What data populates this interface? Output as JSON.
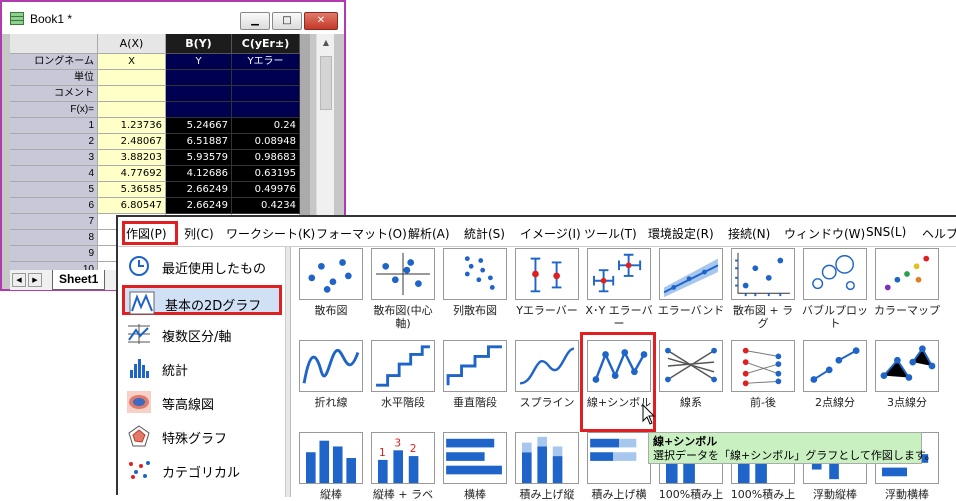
{
  "book": {
    "title": "Book1 *",
    "buttons": {
      "minimize": "minimize-icon",
      "maximize": "maximize-icon",
      "close": "close-icon"
    },
    "sheet_tab": "Sheet1"
  },
  "worksheet": {
    "columns": [
      {
        "header": "A(X)"
      },
      {
        "header": "B(Y)"
      },
      {
        "header": "C(yEr±)"
      }
    ],
    "meta_labels": [
      "ロングネーム",
      "単位",
      "コメント",
      "F(x)="
    ],
    "long_names": [
      "X",
      "Y",
      "Yエラー"
    ],
    "row_numbers": [
      "1",
      "2",
      "3",
      "4",
      "5",
      "6",
      "7",
      "8",
      "9",
      "10"
    ],
    "rows": [
      [
        "1.23736",
        "5.24667",
        "0.24"
      ],
      [
        "2.48067",
        "6.51887",
        "0.08948"
      ],
      [
        "3.88203",
        "5.93579",
        "0.98683"
      ],
      [
        "4.77692",
        "4.12686",
        "0.63195"
      ],
      [
        "5.36585",
        "2.66249",
        "0.49976"
      ],
      [
        "6.80547",
        "2.66249",
        "0.4234"
      ],
      [
        "",
        "",
        ""
      ],
      [
        "",
        "",
        ""
      ],
      [
        "",
        "",
        ""
      ],
      [
        "",
        "",
        ""
      ]
    ]
  },
  "menubar": [
    "作図(P)",
    "列(C)",
    "ワークシート(K)",
    "フォーマット(O)",
    "解析(A)",
    "統計(S)",
    "イメージ(I)",
    "ツール(T)",
    "環境設定(R)",
    "接続(N)",
    "ウィンドウ(W)",
    "SNS(L)",
    "ヘルプ"
  ],
  "categories": [
    "最近使用したもの",
    "基本の2Dグラフ",
    "複数区分/軸",
    "統計",
    "等高線図",
    "特殊グラフ",
    "カテゴリカル"
  ],
  "graph_types": {
    "row1": [
      "散布図",
      "散布図(中心軸)",
      "列散布図",
      "Yエラーバー",
      "X･Y エラーバー",
      "エラーバンド",
      "散布図 + ラグ",
      "バブルプロット",
      "カラーマップ"
    ],
    "row2": [
      "折れ線",
      "水平階段",
      "垂直階段",
      "スプライン",
      "線+シンボル",
      "線系",
      "前-後",
      "2点線分",
      "3点線分"
    ],
    "row3": [
      "縦棒",
      "縦棒 + ラベ",
      "横棒",
      "積み上げ縦",
      "積み上げ横",
      "100%積み上",
      "100%積み上",
      "浮動縦棒",
      "浮動横棒"
    ]
  },
  "tooltip": {
    "title": "線+シンボル",
    "text": "選択データを「線+シンボル」グラフとして作図します。"
  },
  "colors": {
    "accent": "#1f64c8",
    "highlight": "#e02020",
    "tooltip_bg": "#c8f0c0"
  }
}
